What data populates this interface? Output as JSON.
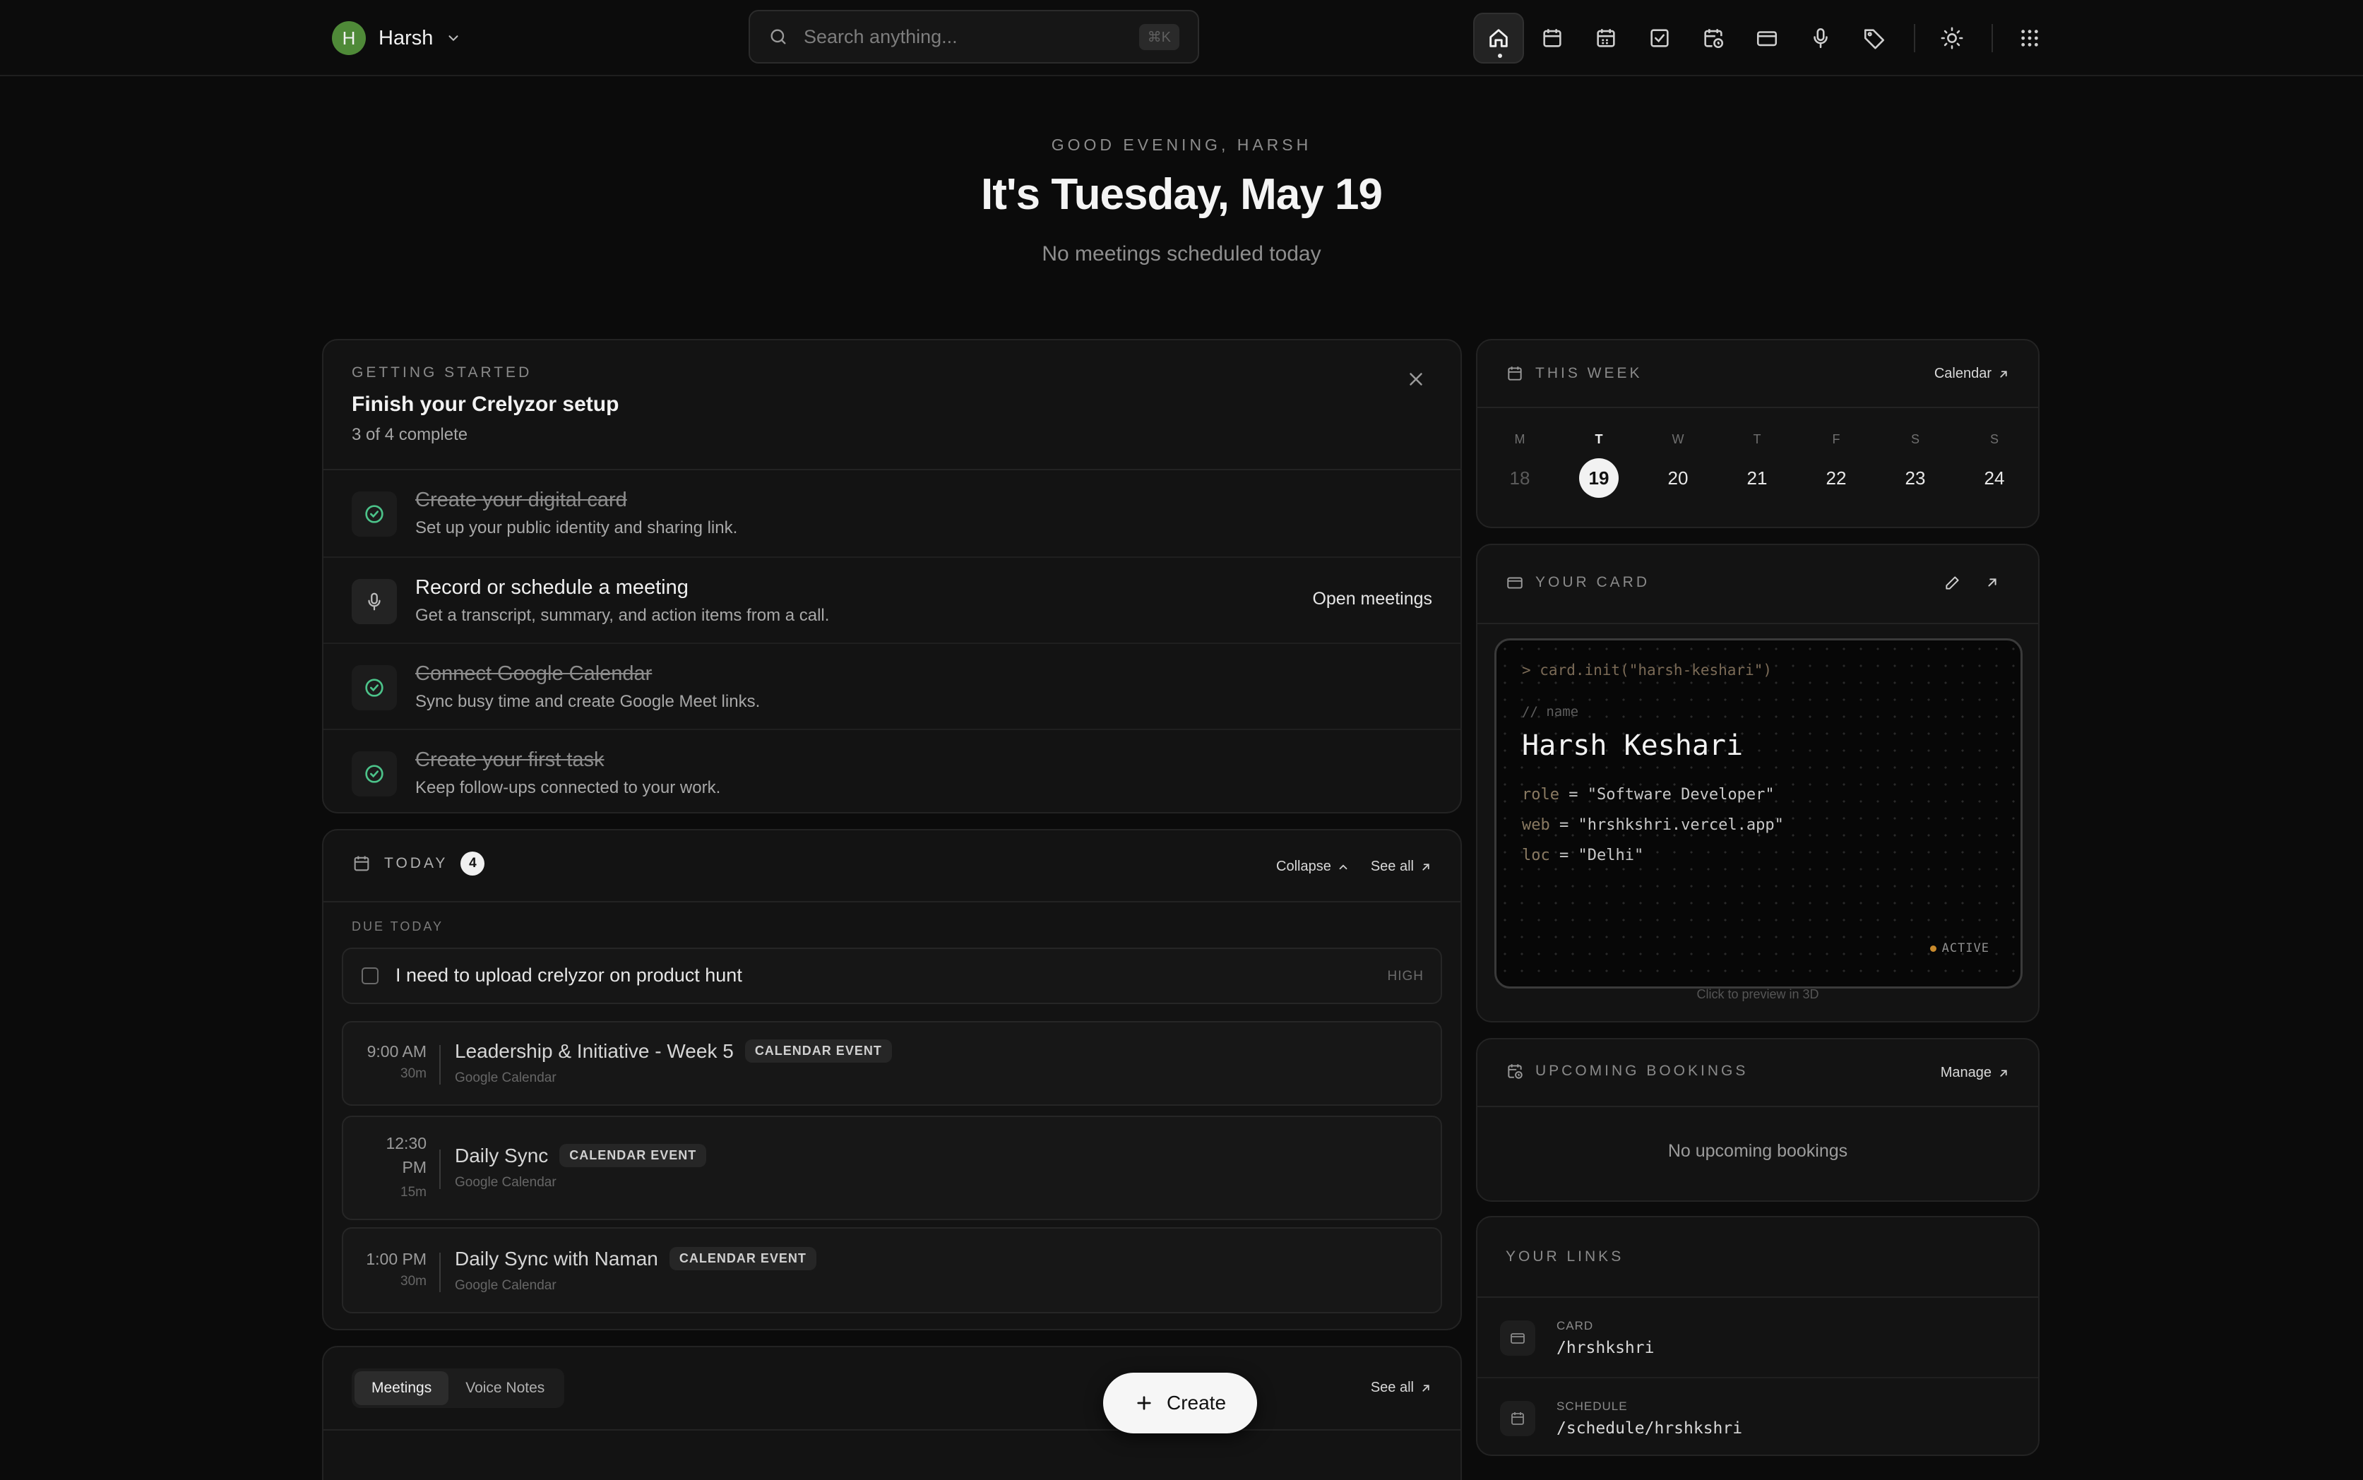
{
  "header": {
    "user_initial": "H",
    "user_name": "Harsh",
    "search_placeholder": "Search anything...",
    "search_shortcut": "⌘K",
    "nav_icons": [
      "home-icon",
      "calendar-icon",
      "calendar-grid-icon",
      "task-check-icon",
      "calendar-clock-icon",
      "card-icon",
      "mic-icon",
      "tag-icon",
      "sun-icon",
      "apps-grid-icon"
    ]
  },
  "greeting": {
    "eyebrow": "GOOD EVENING, HARSH",
    "title": "It's Tuesday, May 19",
    "subtitle": "No meetings scheduled today"
  },
  "setup": {
    "eyebrow": "GETTING STARTED",
    "title": "Finish your Crelyzor setup",
    "progress": "3 of 4 complete",
    "progress_done": 3,
    "progress_total": 4,
    "items": [
      {
        "title": "Create your digital card",
        "desc": "Set up your public identity and sharing link.",
        "done": true
      },
      {
        "title": "Record or schedule a meeting",
        "desc": "Get a transcript, summary, and action items from a call.",
        "done": false,
        "action": "Open meetings"
      },
      {
        "title": "Connect Google Calendar",
        "desc": "Sync busy time and create Google Meet links.",
        "done": true
      },
      {
        "title": "Create your first task",
        "desc": "Keep follow-ups connected to your work.",
        "done": true
      }
    ]
  },
  "today": {
    "label": "TODAY",
    "count": "4",
    "collapse": "Collapse",
    "see_all": "See all",
    "due_label": "DUE TODAY",
    "task": {
      "title": "I need to upload crelyzor on product hunt",
      "priority": "HIGH"
    },
    "events": [
      {
        "time": "9:00 AM",
        "duration": "30m",
        "title": "Leadership & Initiative - Week 5",
        "badge": "CALENDAR EVENT",
        "source": "Google Calendar"
      },
      {
        "time_line1": "12:30",
        "time_line2": "PM",
        "duration": "15m",
        "title": "Daily Sync",
        "badge": "CALENDAR EVENT",
        "source": "Google Calendar"
      },
      {
        "time": "1:00 PM",
        "duration": "30m",
        "title": "Daily Sync with Naman",
        "badge": "CALENDAR EVENT",
        "source": "Google Calendar"
      }
    ]
  },
  "activity": {
    "tabs": [
      "Meetings",
      "Voice Notes"
    ],
    "see_all": "See all",
    "create": "Create"
  },
  "week": {
    "label": "THIS WEEK",
    "link": "Calendar",
    "days": [
      {
        "l": "M",
        "n": "18",
        "state": "past"
      },
      {
        "l": "T",
        "n": "19",
        "state": "today"
      },
      {
        "l": "W",
        "n": "20",
        "state": ""
      },
      {
        "l": "T",
        "n": "21",
        "state": ""
      },
      {
        "l": "F",
        "n": "22",
        "state": ""
      },
      {
        "l": "S",
        "n": "23",
        "state": ""
      },
      {
        "l": "S",
        "n": "24",
        "state": ""
      }
    ]
  },
  "card": {
    "label": "YOUR CARD",
    "cmd": "> card.init(\"harsh-keshari\")",
    "comment": "// name",
    "name": "Harsh Keshari",
    "fields": [
      {
        "k": "role",
        "v": " = \"Software Developer\""
      },
      {
        "k": "web",
        "v": " = \"hrshkshri.vercel.app\""
      },
      {
        "k": "loc",
        "v": " = \"Delhi\""
      }
    ],
    "status": "ACTIVE",
    "hint": "Click to preview in 3D"
  },
  "bookings": {
    "label": "UPCOMING BOOKINGS",
    "link": "Manage",
    "empty": "No upcoming bookings"
  },
  "links": {
    "label": "YOUR LINKS",
    "items": [
      {
        "k": "CARD",
        "v": "/hrshkshri"
      },
      {
        "k": "SCHEDULE",
        "v": "/schedule/hrshkshri"
      }
    ]
  },
  "colors": {
    "background": "#0b0b0b",
    "card": "#131313",
    "avatar": "#4f8a38",
    "check_green": "#4cc38a",
    "active_dot": "#c98a2c"
  }
}
